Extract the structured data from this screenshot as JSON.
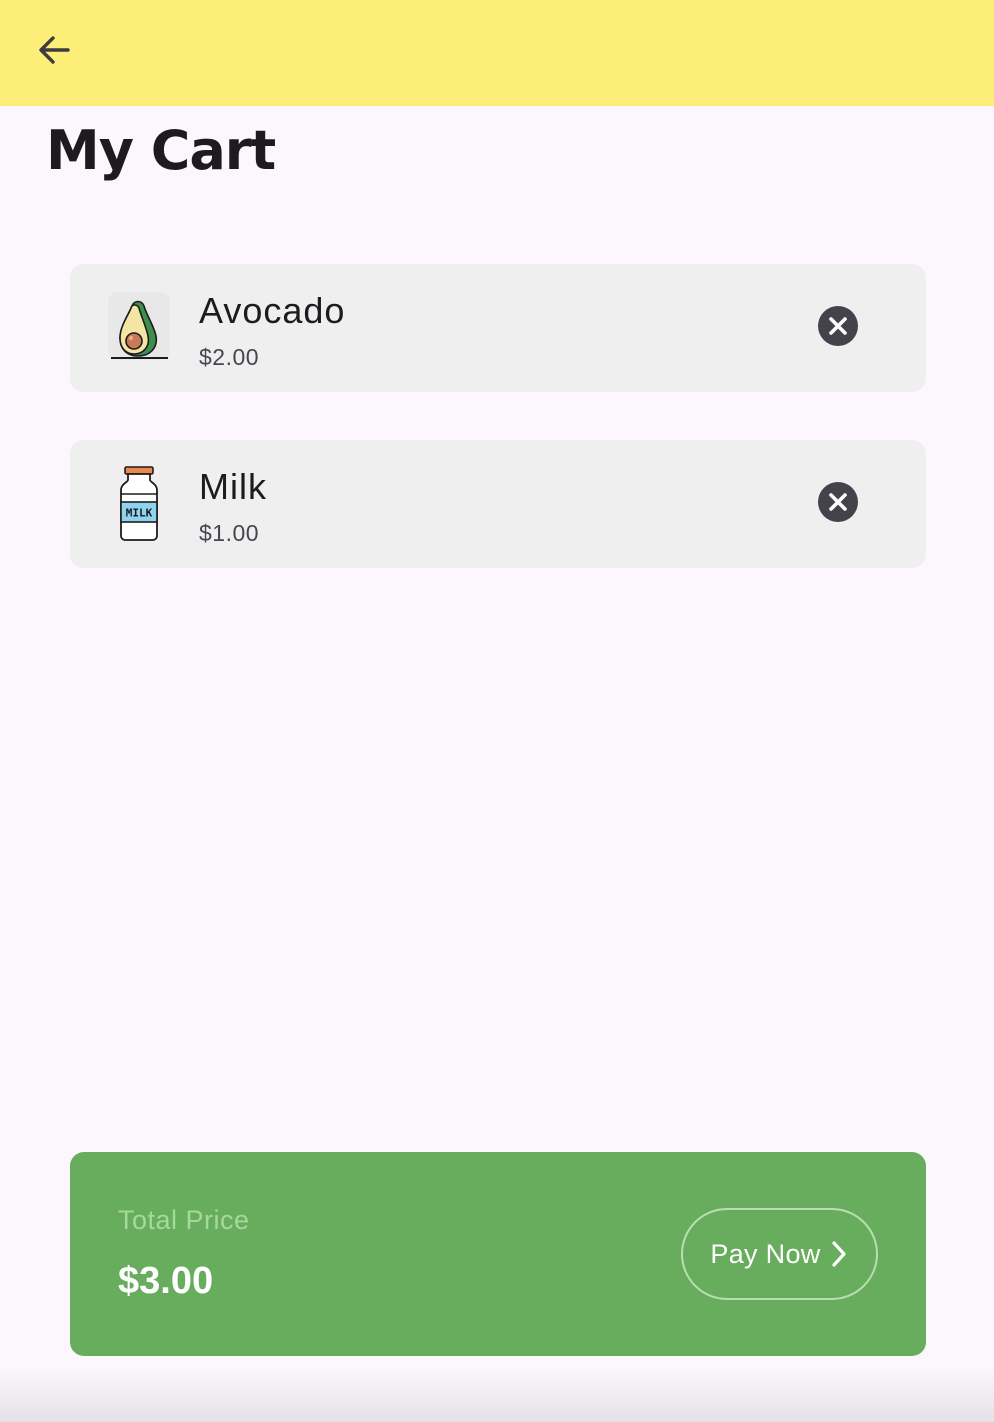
{
  "header": {
    "back_icon": "arrow-left-icon",
    "background_color": "#fdee78"
  },
  "page": {
    "title": "My Cart"
  },
  "cart": {
    "items": [
      {
        "name": "Avocado",
        "price": "$2.00",
        "icon": "avocado-icon",
        "remove_icon": "close-circle-icon"
      },
      {
        "name": "Milk",
        "price": "$1.00",
        "icon": "milk-bottle-icon",
        "icon_label": "MILK",
        "remove_icon": "close-circle-icon"
      }
    ]
  },
  "summary": {
    "total_label": "Total Price",
    "total_value": "$3.00",
    "pay_label": "Pay Now",
    "pay_icon": "chevron-right-icon",
    "accent_color": "#68ad5d"
  }
}
